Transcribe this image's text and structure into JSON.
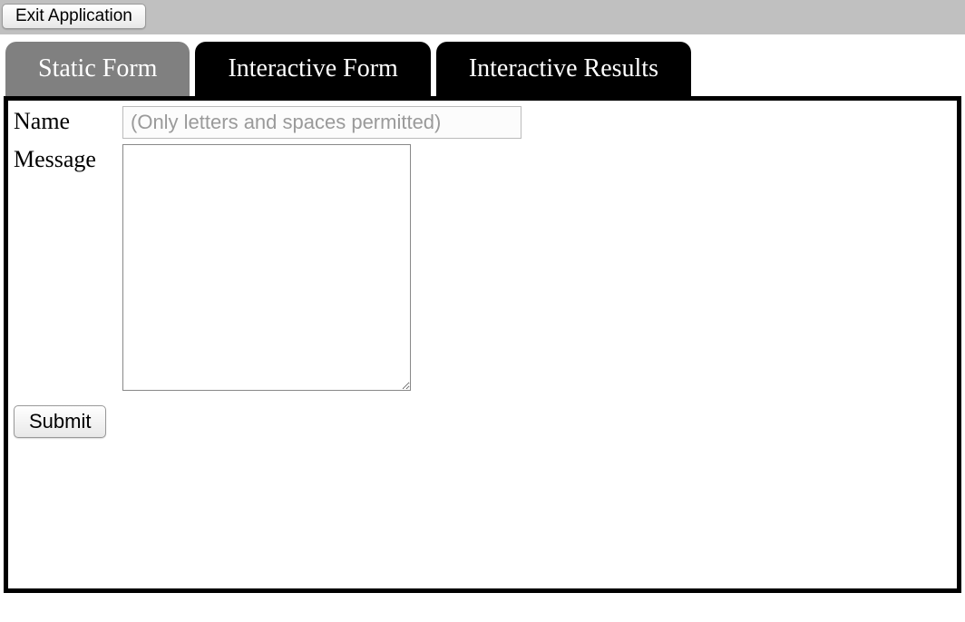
{
  "toolbar": {
    "exit_label": "Exit Application"
  },
  "tabs": [
    {
      "label": "Static Form",
      "active": true
    },
    {
      "label": "Interactive Form",
      "active": false
    },
    {
      "label": "Interactive Results",
      "active": false
    }
  ],
  "form": {
    "name_label": "Name",
    "name_placeholder": "(Only letters and spaces permitted)",
    "name_value": "",
    "message_label": "Message",
    "message_value": "",
    "submit_label": "Submit"
  }
}
